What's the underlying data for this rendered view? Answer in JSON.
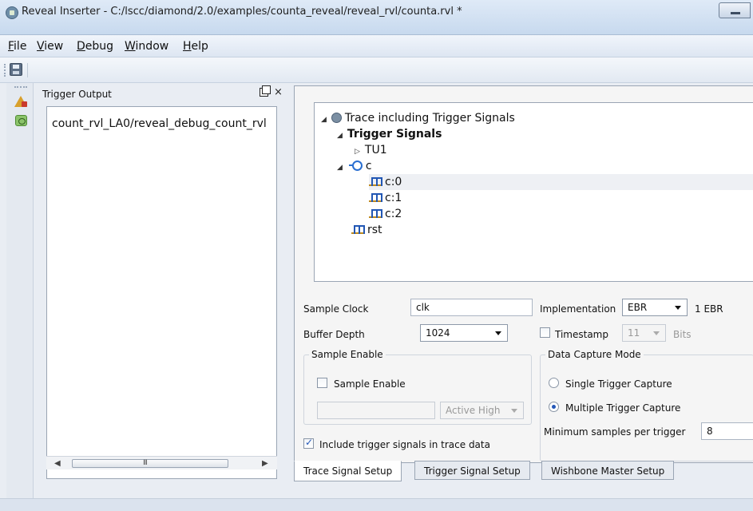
{
  "window": {
    "title": "Reveal Inserter - C:/lscc/diamond/2.0/examples/counta_reveal/reveal_rvl/counta.rvl *"
  },
  "menu": [
    "File",
    "View",
    "Debug",
    "Window",
    "Help"
  ],
  "trigger_output": {
    "title": "Trigger Output",
    "items": [
      "count_rvl_LA0/reveal_debug_count_rvl"
    ]
  },
  "tree": {
    "root": "Trace including Trigger Signals",
    "trigger_signals": "Trigger Signals",
    "tu1": "TU1",
    "bus": "c",
    "bits": [
      "c:0",
      "c:1",
      "c:2"
    ],
    "rst": "rst"
  },
  "form": {
    "sample_clock_label": "Sample Clock",
    "sample_clock_value": "clk",
    "buffer_depth_label": "Buffer Depth",
    "buffer_depth_value": "1024",
    "implementation_label": "Implementation",
    "implementation_value": "EBR",
    "implementation_count": "1 EBR",
    "timestamp_label": "Timestamp",
    "timestamp_value": "11",
    "timestamp_unit": "Bits",
    "timestamp_checked": false,
    "sample_enable_group": "Sample Enable",
    "sample_enable_check": "Sample Enable",
    "sample_enable_checked": false,
    "sample_enable_input": "",
    "sample_enable_polarity": "Active High",
    "data_capture_group": "Data Capture Mode",
    "single_trigger": "Single Trigger Capture",
    "multiple_trigger": "Multiple Trigger Capture",
    "capture_mode_selected": "Multiple Trigger Capture",
    "min_samples_label": "Minimum samples per trigger",
    "min_samples_value": "8",
    "include_trigger_label": "Include trigger signals in trace data",
    "include_trigger_checked": true
  },
  "tabs": [
    "Trace Signal Setup",
    "Trigger Signal Setup",
    "Wishbone Master Setup"
  ],
  "active_tab": "Trace Signal Setup"
}
